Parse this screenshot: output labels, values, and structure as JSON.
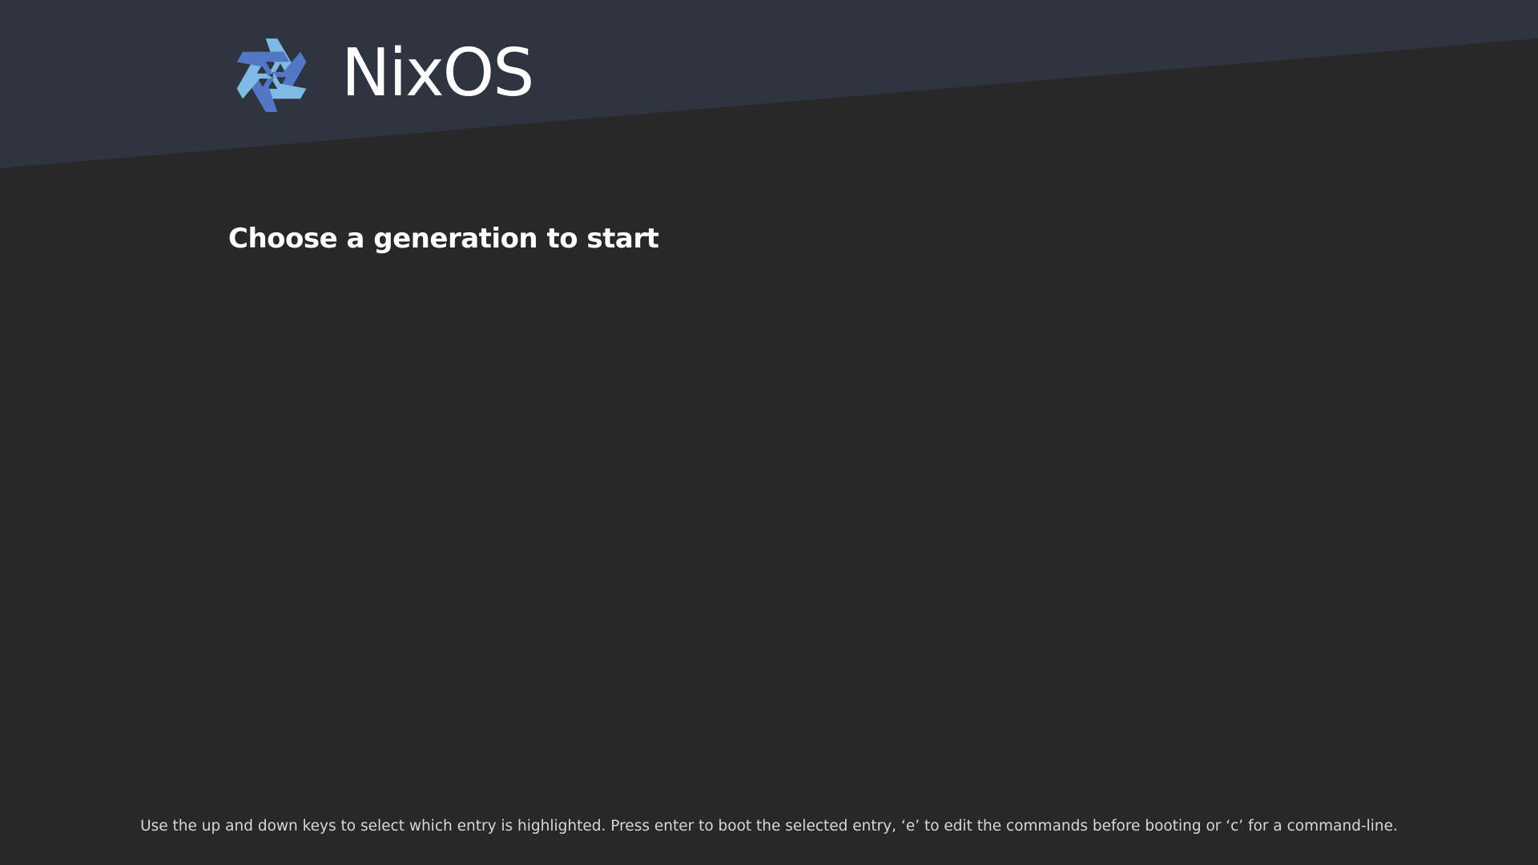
{
  "colors": {
    "background": "#282828",
    "header_band": "#2e3440",
    "text_primary": "#ffffff",
    "text_help": "#d8d8d8",
    "logo_light_blue": "#7ebae4",
    "logo_dark_blue": "#5277c3"
  },
  "brand": {
    "logo_icon": "nixos-snowflake-icon",
    "name": "NixOS"
  },
  "menu": {
    "title": "Choose a generation to start",
    "entries": []
  },
  "footer": {
    "help_text": "Use the up and down keys to select which entry is highlighted. Press enter to boot the selected entry, ‘e’ to edit the commands before booting or ‘c’ for a command-line."
  }
}
